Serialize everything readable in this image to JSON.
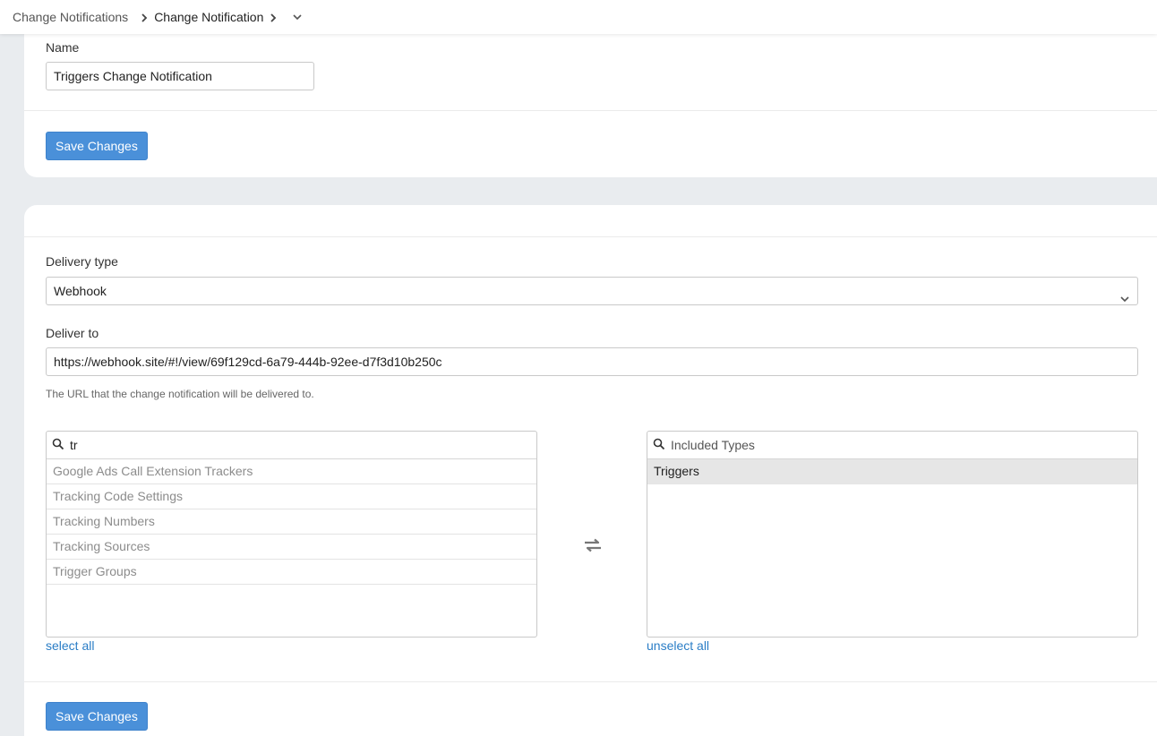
{
  "breadcrumb": {
    "items": [
      "Change Notifications",
      "Change Notification"
    ]
  },
  "name_section": {
    "label": "Name",
    "value": "Triggers Change Notification",
    "save_label": "Save Changes"
  },
  "delivery_section": {
    "delivery_type_label": "Delivery type",
    "delivery_type_value": "Webhook",
    "deliver_to_label": "Deliver to",
    "deliver_to_value": "https://webhook.site/#!/view/69f129cd-6a79-444b-92ee-d7f3d10b250c",
    "deliver_to_help": "The URL that the change notification will be delivered to."
  },
  "available_list": {
    "search_value": "tr",
    "items": [
      "Google Ads Call Extension Trackers",
      "Tracking Code Settings",
      "Tracking Numbers",
      "Tracking Sources",
      "Trigger Groups"
    ],
    "select_all_label": "select all"
  },
  "included_list": {
    "search_placeholder": "Included Types",
    "items": [
      "Triggers"
    ],
    "unselect_all_label": "unselect all"
  },
  "footer": {
    "save_label": "Save Changes"
  },
  "colors": {
    "primary": "#4a90d9",
    "link": "#2a7dc6",
    "background": "#e9ecef"
  }
}
